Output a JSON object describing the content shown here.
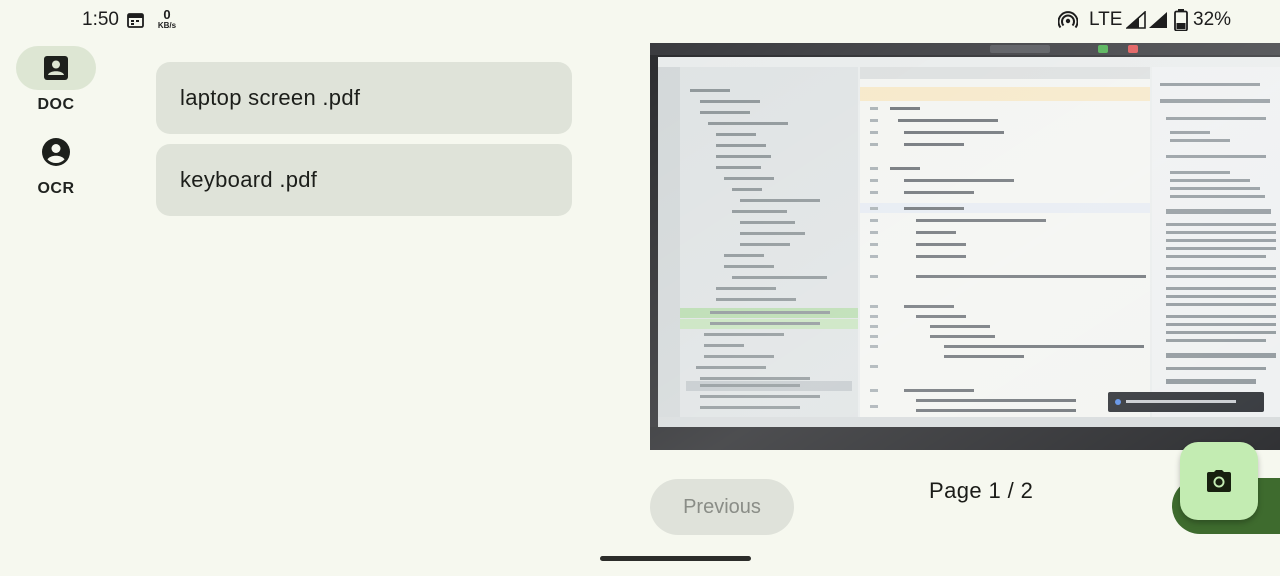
{
  "status_bar": {
    "time": "1:50",
    "net_speed_value": "0",
    "net_speed_unit": "KB/s",
    "network_type": "LTE",
    "battery": "32%"
  },
  "nav_rail": {
    "items": [
      {
        "label": "DOC",
        "icon": "document-icon",
        "active": true
      },
      {
        "label": "OCR",
        "icon": "account-circle-icon",
        "active": false
      }
    ]
  },
  "files": [
    {
      "name": "laptop screen .pdf"
    },
    {
      "name": "keyboard .pdf"
    }
  ],
  "preview": {
    "description_hint": "photo of laptop screen showing Android Studio"
  },
  "pager": {
    "previous_label": "Previous",
    "page_label": "Page 1 / 2"
  },
  "fab": {
    "icon": "camera-icon"
  },
  "colors": {
    "background": "#f6f8ef",
    "card": "#dfe3d9",
    "rail_active": "#dde6d3",
    "fab": "#c3ecb2",
    "next_button": "#3e6b2e"
  }
}
